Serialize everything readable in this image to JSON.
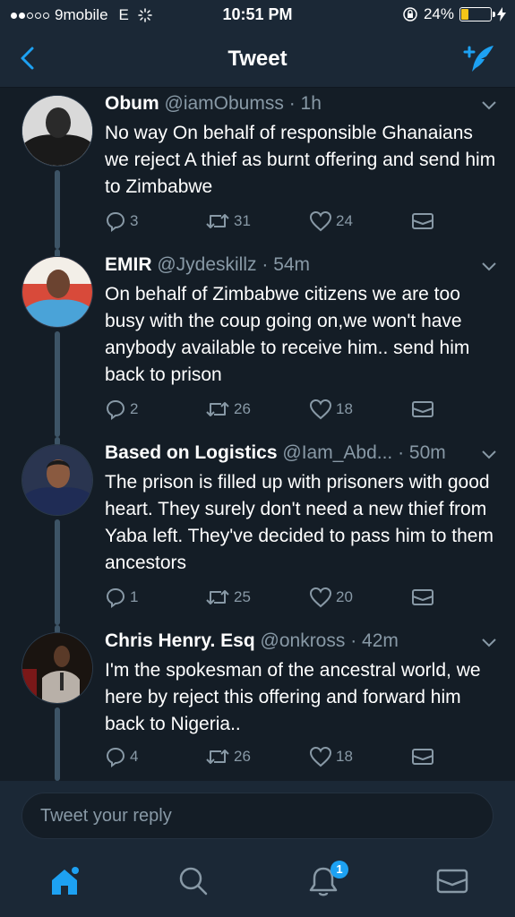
{
  "status_bar": {
    "carrier": "9mobile",
    "network": "E",
    "time": "10:51 PM",
    "battery_percent": "24%",
    "battery_level": 0.24
  },
  "nav": {
    "title": "Tweet",
    "back_icon": "chevron-left-icon",
    "compose_icon": "compose-tweet-icon"
  },
  "colors": {
    "background": "#141d26",
    "bar": "#1b2836",
    "accent": "#1da1f2",
    "muted": "#8899a6"
  },
  "tweets": [
    {
      "name": "Obum",
      "handle": "@iamObumss",
      "time": "· 1h",
      "text": "No way On behalf of responsible Ghanaians we reject A thief as burnt offering and send him to Zimbabwe",
      "replies": "3",
      "retweets": "31",
      "likes": "24"
    },
    {
      "name": "EMIR",
      "handle": "@Jydeskillz",
      "time": "· 54m",
      "text": "On behalf of Zimbabwe citizens we are too busy with the coup going on,we won't have anybody available to receive him.. send him back to prison",
      "replies": "2",
      "retweets": "26",
      "likes": "18"
    },
    {
      "name": "Based on Logistics",
      "handle": "@Iam_Abd...",
      "time": "· 50m",
      "text": "The prison is filled up with prisoners with good heart. They surely don't need a new thief from Yaba left. They've decided to pass him to them ancestors",
      "replies": "1",
      "retweets": "25",
      "likes": "20"
    },
    {
      "name": "Chris Henry. Esq",
      "handle": "@onkross",
      "time": "· 42m",
      "text": "I'm the spokesman of the ancestral world, we here by reject this offering and forward him back to Nigeria..",
      "replies": "4",
      "retweets": "26",
      "likes": "18"
    }
  ],
  "reply": {
    "placeholder": "Tweet your reply"
  },
  "tab_bar": {
    "items": [
      "home-icon",
      "search-icon",
      "notifications-icon",
      "messages-icon"
    ],
    "notification_count": "1"
  }
}
